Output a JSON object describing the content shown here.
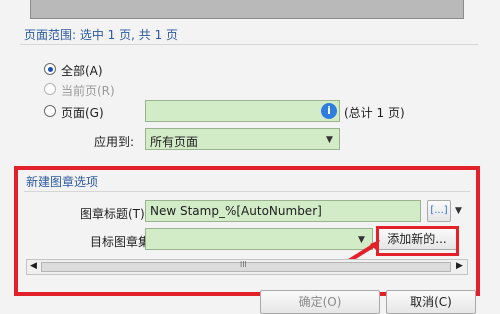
{
  "page_range": {
    "header": "页面范围: 选中 1 页, 共 1 页",
    "options": {
      "all": "全部(A)",
      "current": "当前页(R)",
      "pages": "页面(G)"
    },
    "pages_input_value": "",
    "total_text": "(总计 1 页)",
    "apply_to_label": "应用到:",
    "apply_to_value": "所有页面"
  },
  "new_stamp": {
    "section_title": "新建图章选项",
    "title_label": "图章标题(T):",
    "title_value": "New Stamp_%[AutoNumber]",
    "title_macro_button": "[...]",
    "target_label": "目标图章集:",
    "target_value": "",
    "add_new_button": "添加新的...",
    "scrollbar_grip": "lll"
  },
  "footer": {
    "ok_button": "确定(O)",
    "cancel_button": "取消(C)"
  },
  "colors": {
    "highlight_red": "#e2212b",
    "field_green": "#d3ecc8",
    "section_blue": "#2c5aa0"
  },
  "icons": {
    "info": "info-icon",
    "dropdown": "chevron-down-icon",
    "scroll_left": "arrow-left-icon",
    "scroll_right": "arrow-right-icon"
  }
}
